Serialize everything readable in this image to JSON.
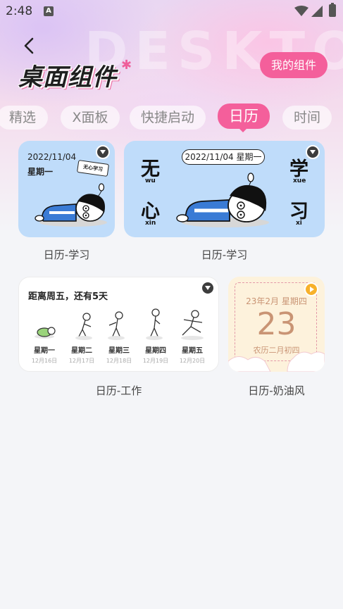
{
  "status_bar": {
    "time": "2:48",
    "app_icon_letter": "A"
  },
  "header": {
    "watermark": "DESKTOP",
    "title": "桌面组件",
    "my_widgets_label": "我的组件"
  },
  "tabs": [
    {
      "label": "精选",
      "active": false
    },
    {
      "label": "X面板",
      "active": false
    },
    {
      "label": "快捷启动",
      "active": false
    },
    {
      "label": "日历",
      "active": true
    },
    {
      "label": "时间",
      "active": false
    }
  ],
  "widgets": {
    "study_small": {
      "date": "2022/11/04",
      "weekday": "星期一",
      "sign_text": "无心学习",
      "label": "日历-学习"
    },
    "study_wide": {
      "date_pill": "2022/11/04  星期一",
      "chars": [
        {
          "char": "无",
          "pinyin": "wu"
        },
        {
          "char": "学",
          "pinyin": "xue"
        },
        {
          "char": "心",
          "pinyin": "xin"
        },
        {
          "char": "习",
          "pinyin": "xi"
        }
      ],
      "label": "日历-学习"
    },
    "work": {
      "headline": "距离周五，还有5天",
      "days": [
        {
          "day": "星期一",
          "date": "12月16日"
        },
        {
          "day": "星期二",
          "date": "12月17日"
        },
        {
          "day": "星期三",
          "date": "12月18日"
        },
        {
          "day": "星期四",
          "date": "12月19日"
        },
        {
          "day": "星期五",
          "date": "12月20日"
        }
      ],
      "label": "日历-工作"
    },
    "cream": {
      "month_line": "23年2月 星期四",
      "day_number": "23",
      "lunar": "农历二月初四",
      "label": "日历-奶油风"
    }
  },
  "colors": {
    "accent_pink": "#f45f9b",
    "card_blue": "#bfdcfa",
    "cream_bg": "#fdf2dc",
    "cream_text": "#c99474",
    "badge_dark": "#3d3d3d"
  }
}
